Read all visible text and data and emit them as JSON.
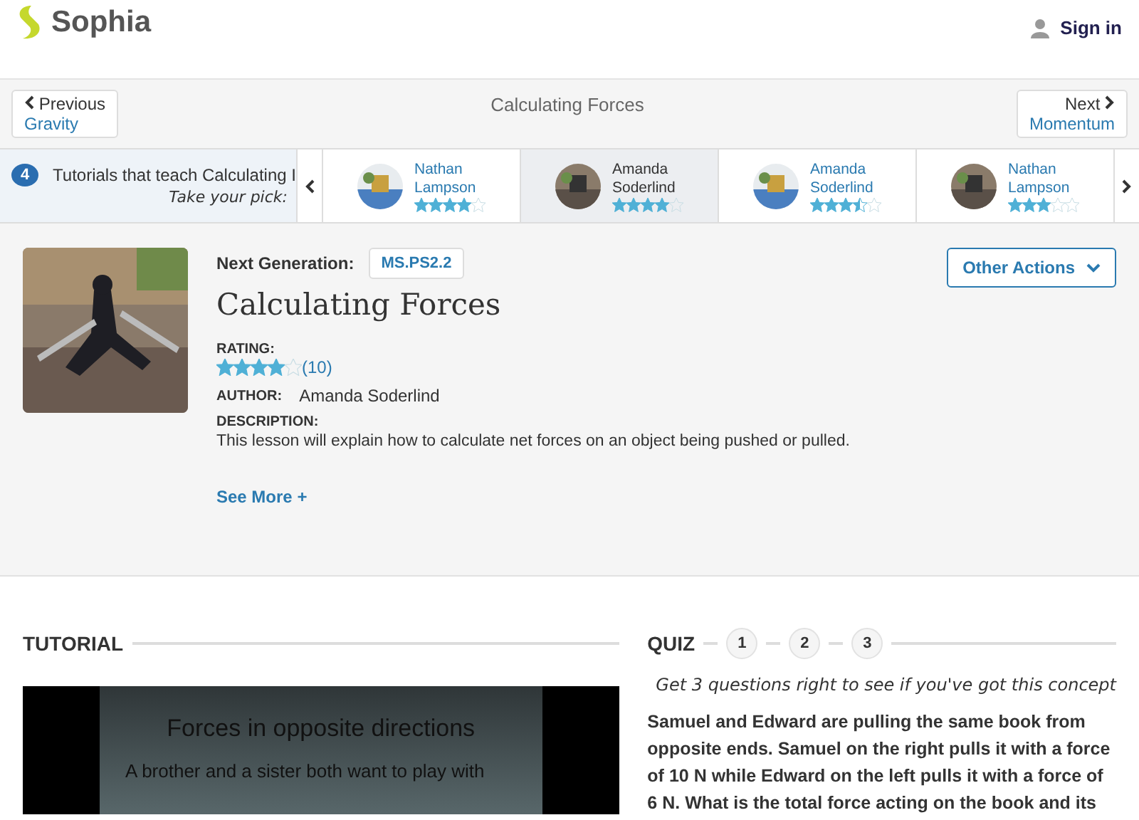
{
  "header": {
    "logo": "Sophia",
    "sign_in": "Sign in"
  },
  "nav": {
    "previous": {
      "label": "Previous",
      "title": "Gravity"
    },
    "title": "Calculating Forces",
    "next": {
      "label": "Next",
      "title": "Momentum"
    }
  },
  "carousel": {
    "count": "4",
    "heading": "Tutorials that teach Calculating I",
    "tagline": "Take your pick:",
    "items": [
      {
        "first": "Nathan",
        "last": "Lampson",
        "stars": 4,
        "selected": false
      },
      {
        "first": "Amanda",
        "last": "Soderlind",
        "stars": 4,
        "selected": true
      },
      {
        "first": "Amanda",
        "last": "Soderlind",
        "stars": 3.5,
        "selected": false
      },
      {
        "first": "Nathan",
        "last": "Lampson",
        "stars": 3,
        "selected": false
      }
    ]
  },
  "lesson": {
    "standard_label": "Next Generation:",
    "standard": "MS.PS2.2",
    "title": "Calculating Forces",
    "actions": "Other Actions",
    "rating_label": "RATING:",
    "stars": 4,
    "rating_count": "(10)",
    "author_label": "AUTHOR:",
    "author": "Amanda Soderlind",
    "description_label": "DESCRIPTION:",
    "description": "This lesson will explain how to calculate net forces on an object being pushed or pulled.",
    "see_more": "See More +"
  },
  "tutorial": {
    "heading": "TUTORIAL",
    "slide_title": "Forces in opposite directions",
    "slide_bullet": "A brother and a sister both want to play with"
  },
  "quiz": {
    "heading": "QUIZ",
    "steps": [
      "1",
      "2",
      "3"
    ],
    "tagline": "Get 3 questions right to see if you've got this concept",
    "question": "Samuel and Edward are pulling the same book from opposite ends. Samuel on the right pulls it with a force of 10 N while Edward on the left pulls it with a force of 6 N. What is the total force acting on the book and its"
  }
}
